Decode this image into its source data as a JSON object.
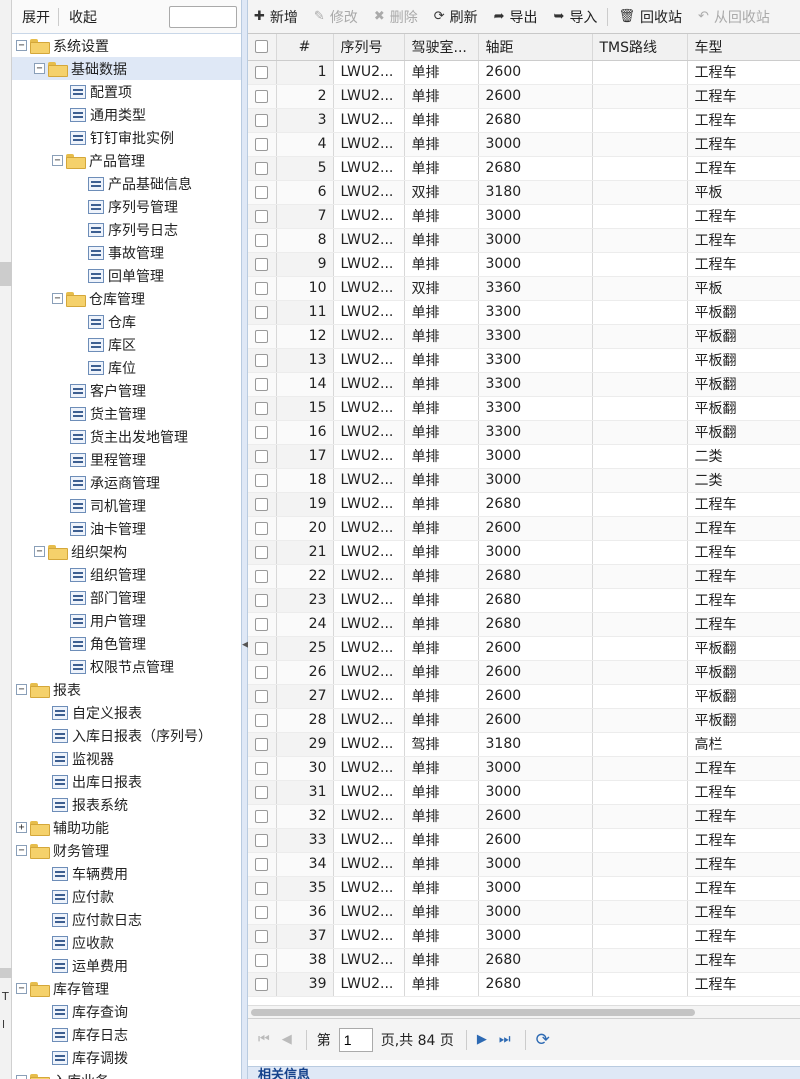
{
  "edge": {
    "t1": "T",
    "t2": "l"
  },
  "tree_toolbar": {
    "expand": "展开",
    "collapse": "收起",
    "search_value": ""
  },
  "tree_nodes": [
    {
      "label": "系统设置",
      "level": 0,
      "type": "folder",
      "toggle": "−"
    },
    {
      "label": "基础数据",
      "level": 1,
      "type": "folder",
      "toggle": "−",
      "selected": true
    },
    {
      "label": "配置项",
      "level": 3,
      "type": "leaf"
    },
    {
      "label": "通用类型",
      "level": 3,
      "type": "leaf"
    },
    {
      "label": "钉钉审批实例",
      "level": 3,
      "type": "leaf"
    },
    {
      "label": "产品管理",
      "level": 2,
      "type": "folder",
      "toggle": "−"
    },
    {
      "label": "产品基础信息",
      "level": 4,
      "type": "leaf"
    },
    {
      "label": "序列号管理",
      "level": 4,
      "type": "leaf"
    },
    {
      "label": "序列号日志",
      "level": 4,
      "type": "leaf"
    },
    {
      "label": "事故管理",
      "level": 4,
      "type": "leaf"
    },
    {
      "label": "回单管理",
      "level": 4,
      "type": "leaf"
    },
    {
      "label": "仓库管理",
      "level": 2,
      "type": "folder",
      "toggle": "−"
    },
    {
      "label": "仓库",
      "level": 4,
      "type": "leaf"
    },
    {
      "label": "库区",
      "level": 4,
      "type": "leaf"
    },
    {
      "label": "库位",
      "level": 4,
      "type": "leaf"
    },
    {
      "label": "客户管理",
      "level": 3,
      "type": "leaf"
    },
    {
      "label": "货主管理",
      "level": 3,
      "type": "leaf"
    },
    {
      "label": "货主出发地管理",
      "level": 3,
      "type": "leaf"
    },
    {
      "label": "里程管理",
      "level": 3,
      "type": "leaf"
    },
    {
      "label": "承运商管理",
      "level": 3,
      "type": "leaf"
    },
    {
      "label": "司机管理",
      "level": 3,
      "type": "leaf"
    },
    {
      "label": "油卡管理",
      "level": 3,
      "type": "leaf"
    },
    {
      "label": "组织架构",
      "level": 1,
      "type": "folder",
      "toggle": "−"
    },
    {
      "label": "组织管理",
      "level": 3,
      "type": "leaf"
    },
    {
      "label": "部门管理",
      "level": 3,
      "type": "leaf"
    },
    {
      "label": "用户管理",
      "level": 3,
      "type": "leaf"
    },
    {
      "label": "角色管理",
      "level": 3,
      "type": "leaf"
    },
    {
      "label": "权限节点管理",
      "level": 3,
      "type": "leaf"
    },
    {
      "label": "报表",
      "level": 0,
      "type": "folder",
      "toggle": "−"
    },
    {
      "label": "自定义报表",
      "level": 2,
      "type": "leaf"
    },
    {
      "label": "入库日报表（序列号）",
      "level": 2,
      "type": "leaf"
    },
    {
      "label": "监视器",
      "level": 2,
      "type": "leaf"
    },
    {
      "label": "出库日报表",
      "level": 2,
      "type": "leaf"
    },
    {
      "label": "报表系统",
      "level": 2,
      "type": "leaf"
    },
    {
      "label": "辅助功能",
      "level": 0,
      "type": "folder",
      "toggle": "+"
    },
    {
      "label": "财务管理",
      "level": 0,
      "type": "folder",
      "toggle": "−"
    },
    {
      "label": "车辆费用",
      "level": 2,
      "type": "leaf"
    },
    {
      "label": "应付款",
      "level": 2,
      "type": "leaf"
    },
    {
      "label": "应付款日志",
      "level": 2,
      "type": "leaf"
    },
    {
      "label": "应收款",
      "level": 2,
      "type": "leaf"
    },
    {
      "label": "运单费用",
      "level": 2,
      "type": "leaf"
    },
    {
      "label": "库存管理",
      "level": 0,
      "type": "folder",
      "toggle": "−"
    },
    {
      "label": "库存查询",
      "level": 2,
      "type": "leaf"
    },
    {
      "label": "库存日志",
      "level": 2,
      "type": "leaf"
    },
    {
      "label": "库存调拨",
      "level": 2,
      "type": "leaf"
    },
    {
      "label": "入库业务",
      "level": 0,
      "type": "folder",
      "toggle": "−"
    }
  ],
  "toolbar": [
    {
      "label": "新增",
      "icon": "plus-icon",
      "glyph": "✚",
      "disabled": false
    },
    {
      "label": "修改",
      "icon": "pencil-icon",
      "glyph": "✎",
      "disabled": true
    },
    {
      "label": "删除",
      "icon": "x-icon",
      "glyph": "✖",
      "disabled": true
    },
    {
      "label": "刷新",
      "icon": "refresh-icon",
      "glyph": "⟳",
      "disabled": false
    },
    {
      "label": "导出",
      "icon": "export-icon",
      "glyph": "➦",
      "disabled": false
    },
    {
      "label": "导入",
      "icon": "import-icon",
      "glyph": "➥",
      "disabled": false
    },
    {
      "label": "回收站",
      "icon": "trash-icon",
      "glyph": "🗑",
      "disabled": false
    },
    {
      "label": "从回收站",
      "icon": "undo-icon",
      "glyph": "↶",
      "disabled": true
    }
  ],
  "grid": {
    "columns": [
      "#",
      "序列号",
      "驾驶室...",
      "轴距",
      "TMS路线",
      "车型"
    ],
    "rows": [
      [
        "1",
        "LWU2...",
        "单排",
        "2600",
        "",
        "工程车"
      ],
      [
        "2",
        "LWU2...",
        "单排",
        "2600",
        "",
        "工程车"
      ],
      [
        "3",
        "LWU2...",
        "单排",
        "2680",
        "",
        "工程车"
      ],
      [
        "4",
        "LWU2...",
        "单排",
        "3000",
        "",
        "工程车"
      ],
      [
        "5",
        "LWU2...",
        "单排",
        "2680",
        "",
        "工程车"
      ],
      [
        "6",
        "LWU2...",
        "双排",
        "3180",
        "",
        "平板"
      ],
      [
        "7",
        "LWU2...",
        "单排",
        "3000",
        "",
        "工程车"
      ],
      [
        "8",
        "LWU2...",
        "单排",
        "3000",
        "",
        "工程车"
      ],
      [
        "9",
        "LWU2...",
        "单排",
        "3000",
        "",
        "工程车"
      ],
      [
        "10",
        "LWU2...",
        "双排",
        "3360",
        "",
        "平板"
      ],
      [
        "11",
        "LWU2...",
        "单排",
        "3300",
        "",
        "平板翻"
      ],
      [
        "12",
        "LWU2...",
        "单排",
        "3300",
        "",
        "平板翻"
      ],
      [
        "13",
        "LWU2...",
        "单排",
        "3300",
        "",
        "平板翻"
      ],
      [
        "14",
        "LWU2...",
        "单排",
        "3300",
        "",
        "平板翻"
      ],
      [
        "15",
        "LWU2...",
        "单排",
        "3300",
        "",
        "平板翻"
      ],
      [
        "16",
        "LWU2...",
        "单排",
        "3300",
        "",
        "平板翻"
      ],
      [
        "17",
        "LWU2...",
        "单排",
        "3000",
        "",
        "二类"
      ],
      [
        "18",
        "LWU2...",
        "单排",
        "3000",
        "",
        "二类"
      ],
      [
        "19",
        "LWU2...",
        "单排",
        "2680",
        "",
        "工程车"
      ],
      [
        "20",
        "LWU2...",
        "单排",
        "2600",
        "",
        "工程车"
      ],
      [
        "21",
        "LWU2...",
        "单排",
        "3000",
        "",
        "工程车"
      ],
      [
        "22",
        "LWU2...",
        "单排",
        "2680",
        "",
        "工程车"
      ],
      [
        "23",
        "LWU2...",
        "单排",
        "2680",
        "",
        "工程车"
      ],
      [
        "24",
        "LWU2...",
        "单排",
        "2680",
        "",
        "工程车"
      ],
      [
        "25",
        "LWU2...",
        "单排",
        "2600",
        "",
        "平板翻"
      ],
      [
        "26",
        "LWU2...",
        "单排",
        "2600",
        "",
        "平板翻"
      ],
      [
        "27",
        "LWU2...",
        "单排",
        "2600",
        "",
        "平板翻"
      ],
      [
        "28",
        "LWU2...",
        "单排",
        "2600",
        "",
        "平板翻"
      ],
      [
        "29",
        "LWU2...",
        "驾排",
        "3180",
        "",
        "高栏"
      ],
      [
        "30",
        "LWU2...",
        "单排",
        "3000",
        "",
        "工程车"
      ],
      [
        "31",
        "LWU2...",
        "单排",
        "3000",
        "",
        "工程车"
      ],
      [
        "32",
        "LWU2...",
        "单排",
        "2600",
        "",
        "工程车"
      ],
      [
        "33",
        "LWU2...",
        "单排",
        "2600",
        "",
        "工程车"
      ],
      [
        "34",
        "LWU2...",
        "单排",
        "3000",
        "",
        "工程车"
      ],
      [
        "35",
        "LWU2...",
        "单排",
        "3000",
        "",
        "工程车"
      ],
      [
        "36",
        "LWU2...",
        "单排",
        "3000",
        "",
        "工程车"
      ],
      [
        "37",
        "LWU2...",
        "单排",
        "3000",
        "",
        "工程车"
      ],
      [
        "38",
        "LWU2...",
        "单排",
        "2680",
        "",
        "工程车"
      ],
      [
        "39",
        "LWU2...",
        "单排",
        "2680",
        "",
        "工程车"
      ]
    ]
  },
  "pager": {
    "page_prefix": "第",
    "page_value": "1",
    "page_suffix": "页,共 84 页"
  },
  "related": {
    "title": "相关信息"
  },
  "colors": {
    "selected_bg": "#dfe8f6",
    "accent": "#2d6ab3"
  }
}
